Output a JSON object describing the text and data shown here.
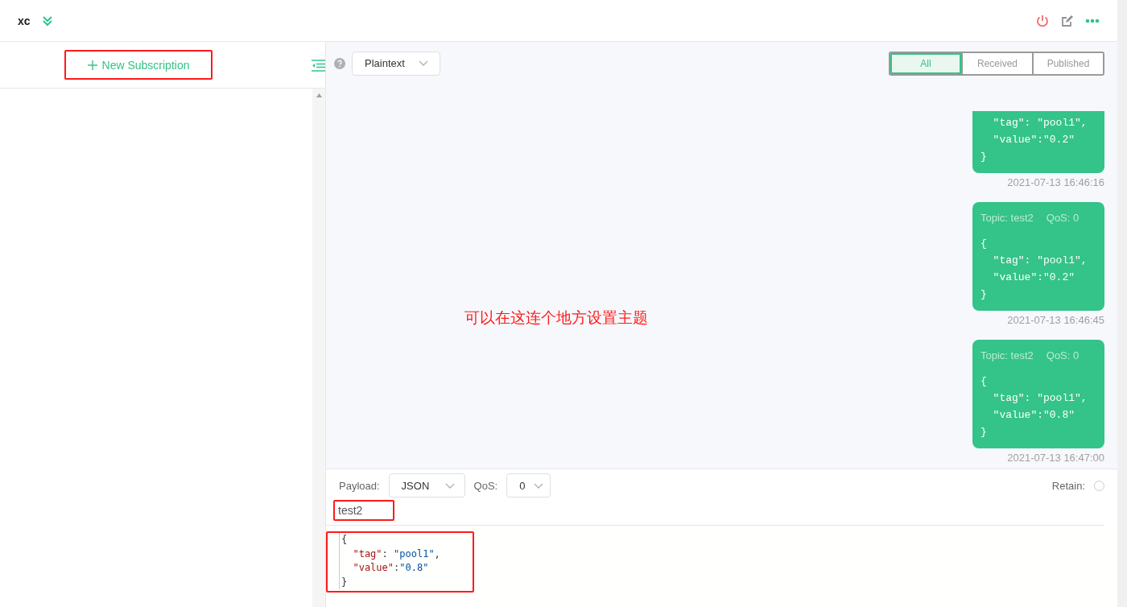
{
  "connection": {
    "name": "xc"
  },
  "sidebar": {
    "new_subscription": "New Subscription"
  },
  "toolbar": {
    "payload_format": "Plaintext",
    "tabs": [
      {
        "label": "All",
        "selected": true
      },
      {
        "label": "Received",
        "selected": false
      },
      {
        "label": "Published",
        "selected": false
      }
    ]
  },
  "messages": [
    {
      "lines": [
        "  \"tag\": \"pool1\",",
        "  \"value\":\"0.2\"",
        "}"
      ],
      "time": "2021-07-13 16:46:16"
    },
    {
      "topic": "Topic: test2",
      "qos": "QoS: 0",
      "lines": [
        "{",
        "  \"tag\": \"pool1\",",
        "  \"value\":\"0.2\"",
        "}"
      ],
      "time": "2021-07-13 16:46:45"
    },
    {
      "topic": "Topic: test2",
      "qos": "QoS: 0",
      "lines": [
        "{",
        "  \"tag\": \"pool1\",",
        "  \"value\":\"0.8\"",
        "}"
      ],
      "time": "2021-07-13 16:47:00"
    }
  ],
  "annotation": "可以在这连个地方设置主题",
  "publish": {
    "payload_label": "Payload:",
    "payload_format": "JSON",
    "qos_label": "QoS:",
    "qos": "0",
    "retain_label": "Retain:",
    "retain_checked": false,
    "topic": "test2",
    "editor_lines": [
      [
        {
          "kind": "punct",
          "text": "{"
        }
      ],
      [
        {
          "kind": "key",
          "text": "  \"tag\""
        },
        {
          "kind": "punct",
          "text": ": "
        },
        {
          "kind": "string",
          "text": "\"pool1\""
        },
        {
          "kind": "punct",
          "text": ","
        }
      ],
      [
        {
          "kind": "key",
          "text": "  \"value\""
        },
        {
          "kind": "punct",
          "text": ":"
        },
        {
          "kind": "string",
          "text": "\"0.8\""
        }
      ],
      [
        {
          "kind": "punct",
          "text": "}"
        }
      ]
    ]
  }
}
